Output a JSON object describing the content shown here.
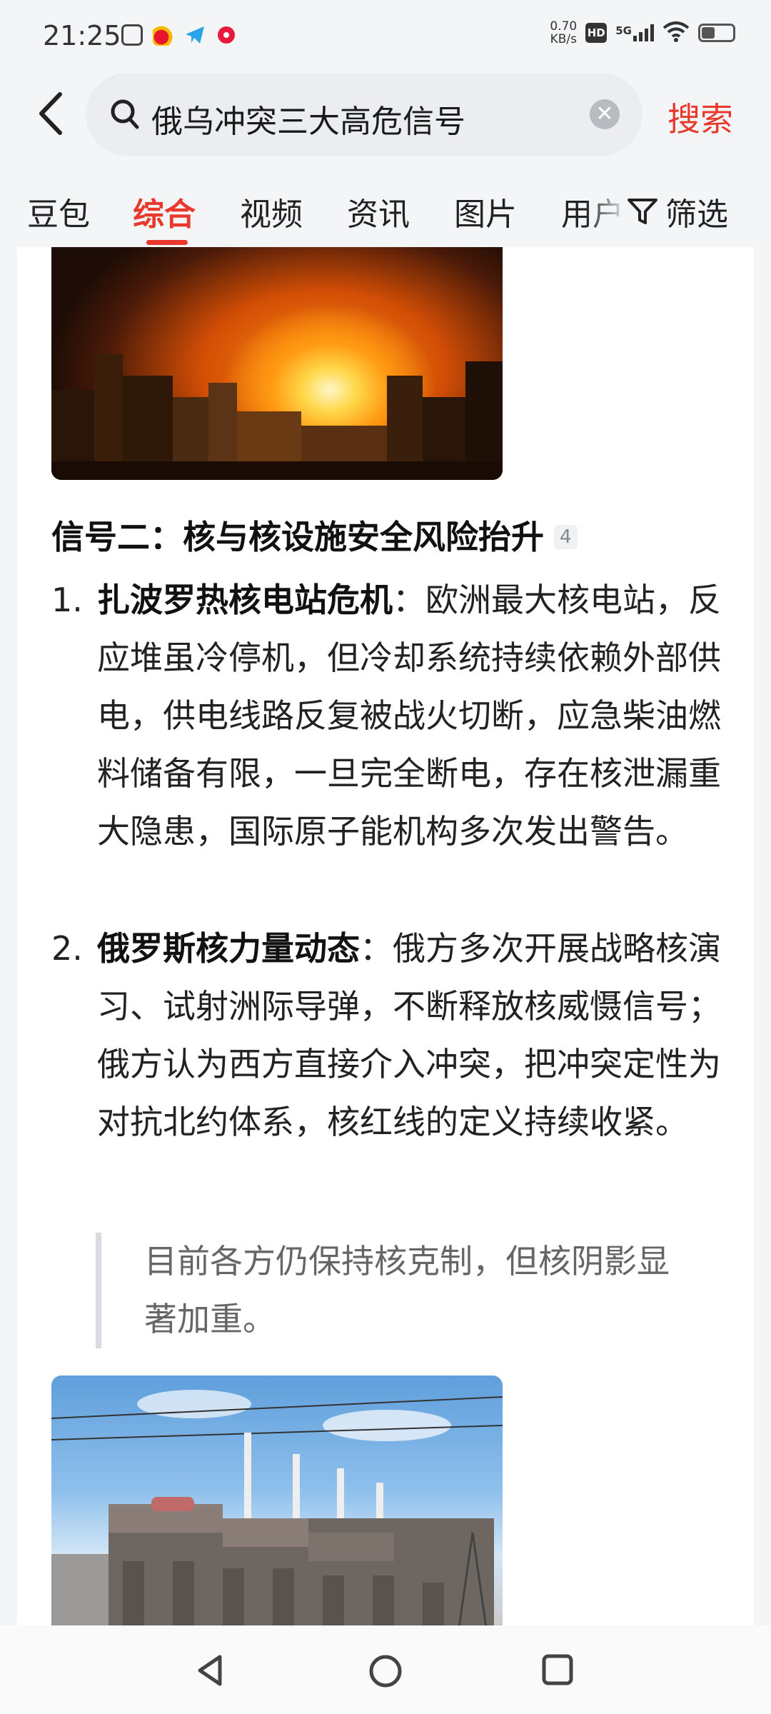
{
  "status_bar": {
    "time": "21:25",
    "net_speed_value": "0.70",
    "net_speed_unit": "KB/s",
    "hd_label": "HD",
    "network_label": "5G",
    "icons": [
      "app-icon-1",
      "weibo-icon",
      "telegram-icon",
      "app-icon-4",
      "signal-icon",
      "wifi-icon",
      "battery-icon"
    ]
  },
  "search": {
    "query": "俄乌冲突三大高危信号",
    "search_button": "搜索"
  },
  "tabs": [
    {
      "label": "豆包"
    },
    {
      "label": "综合",
      "active": true
    },
    {
      "label": "视频"
    },
    {
      "label": "资讯"
    },
    {
      "label": "图片"
    },
    {
      "label": "用户"
    }
  ],
  "filter_label": "筛选",
  "colors": {
    "accent": "#e8392c",
    "background": "#f4f5f7",
    "card": "#ffffff"
  },
  "article": {
    "section_title": "信号二：核与核设施安全风险抬升",
    "citation": "4",
    "items": [
      {
        "num": "1.",
        "heading": "扎波罗热核电站危机",
        "text": "：欧洲最大核电站，反应堆虽冷停机，但冷却系统持续依赖外部供电，供电线路反复被战火切断，应急柴油燃料储备有限，一旦完全断电，存在核泄漏重大隐患，国际原子能机构多次发出警告。"
      },
      {
        "num": "2.",
        "heading": "俄罗斯核力量动态",
        "text": "：俄方多次开展战略核演习、试射洲际导弹，不断释放核威慑信号；俄方认为西方直接介入冲突，把冲突定性为对抗北约体系，核红线的定义持续收紧。"
      }
    ],
    "quote": "目前各方仍保持核克制，但核阴影显著加重。"
  },
  "nav": [
    "back-nav-icon",
    "home-nav-icon",
    "recents-nav-icon"
  ]
}
